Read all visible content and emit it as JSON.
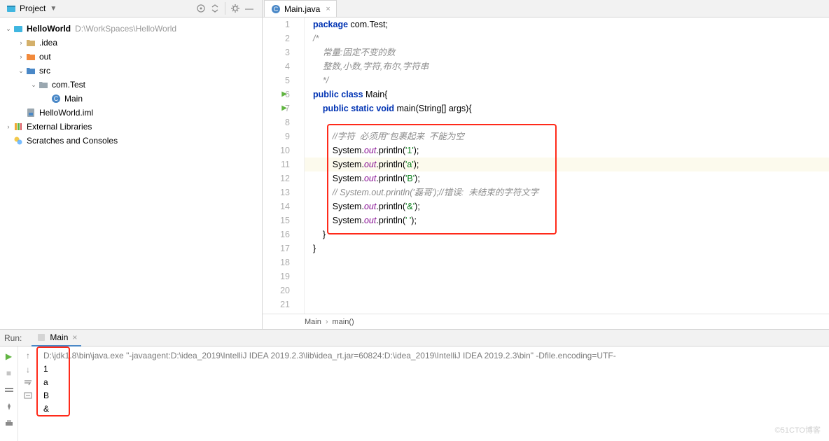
{
  "sidebar": {
    "title": "Project",
    "project": {
      "name": "HelloWorld",
      "path": "D:\\WorkSpaces\\HelloWorld"
    },
    "items": [
      {
        "name": ".idea",
        "type": "folder",
        "arrow": ">"
      },
      {
        "name": "out",
        "type": "folder-orange",
        "arrow": ">"
      },
      {
        "name": "src",
        "type": "folder-blue",
        "arrow": "v"
      },
      {
        "name": "com.Test",
        "type": "package",
        "arrow": "v"
      },
      {
        "name": "Main",
        "type": "class"
      },
      {
        "name": "HelloWorld.iml",
        "type": "iml"
      }
    ],
    "external": "External Libraries",
    "scratches": "Scratches and Consoles"
  },
  "editor": {
    "tab": "Main.java",
    "lines": {
      "l1": {
        "p1": "package",
        "p2": " com.Test;"
      },
      "l2": "/*",
      "l3": "    常量:固定不变的数",
      "l4": "    整数,小数,字符,布尔,字符串",
      "l5": "    */",
      "l6": {
        "p1": "public",
        "p2": " ",
        "p3": "class",
        "p4": " Main{"
      },
      "l7": {
        "p1": "public",
        "p2": " ",
        "p3": "static",
        "p4": " ",
        "p5": "void",
        "p6": " main(String[] args){"
      },
      "l9": "//字符  必须用''包裹起来  不能为空",
      "l10": {
        "s": "System.",
        "o": "out",
        "p": ".println(",
        "v": "'1'",
        "e": ");"
      },
      "l11": {
        "s": "System.",
        "o": "out",
        "p": ".println(",
        "v": "'a'",
        "e": ");"
      },
      "l12": {
        "s": "System.",
        "o": "out",
        "p": ".println(",
        "v": "'B'",
        "e": ");"
      },
      "l13": "// System.out.println('磊哥');//错误:  未结束的字符文字",
      "l14": {
        "s": "System.",
        "o": "out",
        "p": ".println(",
        "v": "'&'",
        "e": ");"
      },
      "l15": {
        "s": "System.",
        "o": "out",
        "p": ".println(",
        "v": "' '",
        "e": ");"
      },
      "l16": "}",
      "l17": "}"
    },
    "breadcrumb": {
      "a": "Main",
      "b": "main()"
    }
  },
  "run": {
    "label": "Run:",
    "tab": "Main",
    "cmd": "D:\\jdk1.8\\bin\\java.exe \"-javaagent:D:\\idea_2019\\IntelliJ IDEA 2019.2.3\\lib\\idea_rt.jar=60824:D:\\idea_2019\\IntelliJ IDEA 2019.2.3\\bin\" -Dfile.encoding=UTF-",
    "out": [
      "1",
      "a",
      "B",
      "&"
    ]
  },
  "watermark": "©51CTO博客"
}
